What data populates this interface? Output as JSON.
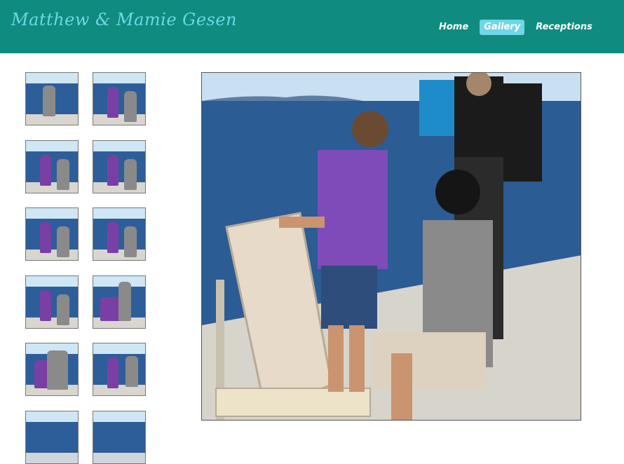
{
  "site_title": "Matthew & Mamie Gesen",
  "nav": {
    "items": [
      {
        "label": "Home",
        "active": false
      },
      {
        "label": "Gallery",
        "active": true
      },
      {
        "label": "Receptions",
        "active": false
      }
    ]
  },
  "colors": {
    "header_bg": "#0f8b7f",
    "title_color": "#6fd6e6",
    "active_tab_bg": "#6fd6e6"
  },
  "gallery": {
    "thumbnail_count_visible": 12,
    "main_photo_alt": "Proposal on boat deck"
  }
}
